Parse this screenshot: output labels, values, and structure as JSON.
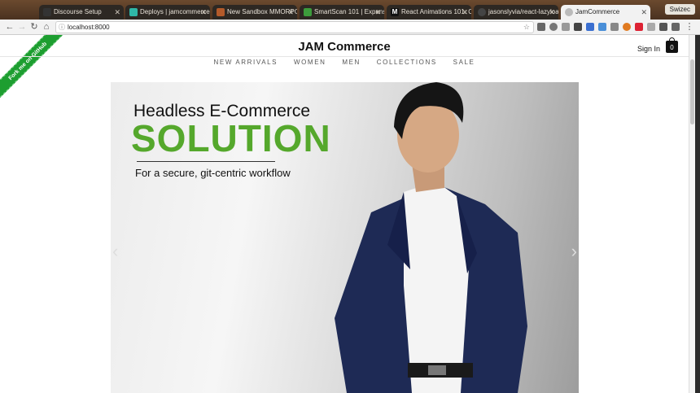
{
  "tabs": [
    {
      "label": "Discourse Setup"
    },
    {
      "label": "Deploys | jamcommerce"
    },
    {
      "label": "New Sandbox MMORPG"
    },
    {
      "label": "SmartScan 101 | Expensi"
    },
    {
      "label": "React Animations 101: CS"
    },
    {
      "label": "jasonslyvia/react-lazyloa"
    },
    {
      "label": "JamCommerce"
    }
  ],
  "profile_name": "Swizec",
  "address": "localhost:8000",
  "page": {
    "ribbon": "Fork me on GitHub",
    "brand": "JAM Commerce",
    "sign_in": "Sign In",
    "cart_count": "0",
    "nav": [
      "NEW ARRIVALS",
      "WOMEN",
      "MEN",
      "COLLECTIONS",
      "SALE"
    ],
    "hero": {
      "headline": "Headless E-Commerce",
      "title": "SOLUTION",
      "subtitle": "For a secure, git-centric workflow"
    }
  },
  "colors": {
    "accent_green": "#55a82c",
    "ribbon_green": "#1d9e30",
    "jacket_navy": "#1e2a55"
  }
}
